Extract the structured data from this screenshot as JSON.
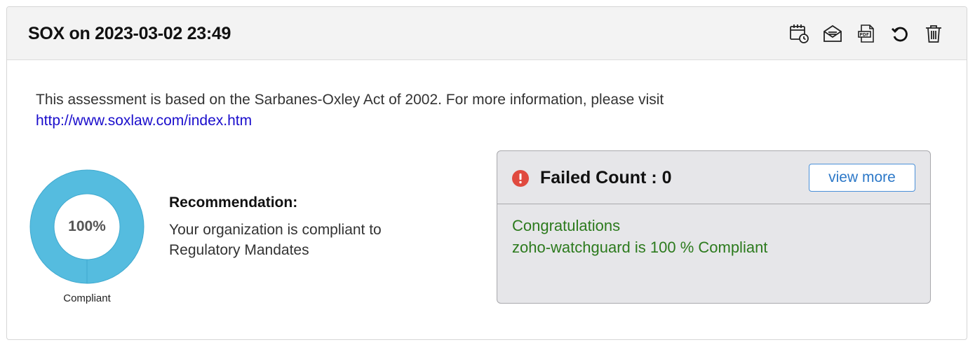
{
  "header": {
    "title": "SOX on 2023-03-02 23:49",
    "actions": [
      {
        "name": "schedule-icon",
        "label": "schedule"
      },
      {
        "name": "email-icon",
        "label": "email"
      },
      {
        "name": "pdf-icon",
        "label": "PDF"
      },
      {
        "name": "refresh-icon",
        "label": "refresh"
      },
      {
        "name": "delete-icon",
        "label": "delete"
      }
    ]
  },
  "intro": {
    "text": "This assessment is based on the Sarbanes-Oxley Act of 2002. For more information, please visit",
    "link": "http://www.soxlaw.com/index.htm"
  },
  "compliance": {
    "percent_label": "100%",
    "percent_value": 100,
    "caption": "Compliant",
    "color": "#55bcdf"
  },
  "recommendation": {
    "title": "Recommendation:",
    "text": "Your organization is compliant to Regulatory Mandates"
  },
  "status": {
    "failed_label": "Failed Count : 0",
    "view_more": "view more",
    "line1": "Congratulations",
    "line2": "zoho-watchguard is 100 % Compliant",
    "alert_color": "#e04a3f",
    "success_color": "#2c7a1d"
  }
}
